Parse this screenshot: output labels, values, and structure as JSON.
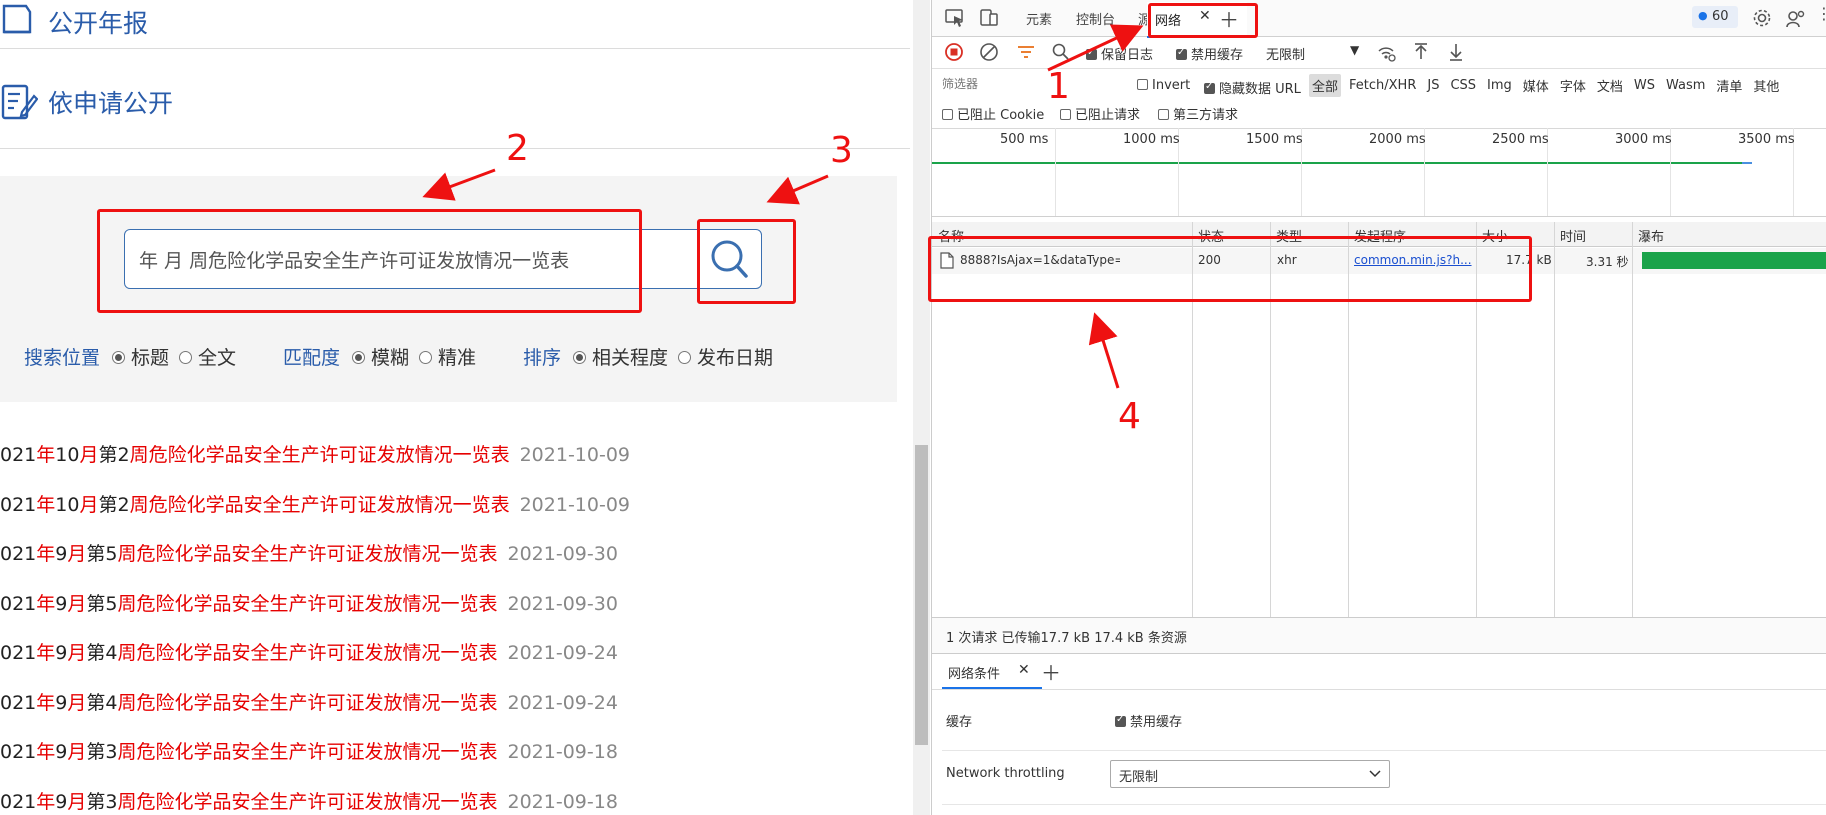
{
  "left": {
    "nav_items": [
      {
        "label": "公开年报",
        "icon": "annual-report-icon"
      },
      {
        "label": "依申请公开",
        "icon": "application-form-icon"
      }
    ],
    "search": {
      "value": "年 月 周危险化学品安全生产许可证发放情况一览表",
      "button_icon": "search-icon"
    },
    "options": [
      {
        "label": "搜索位置",
        "choices": [
          {
            "text": "标题",
            "selected": true
          },
          {
            "text": "全文",
            "selected": false
          }
        ]
      },
      {
        "label": "匹配度",
        "choices": [
          {
            "text": "模糊",
            "selected": true
          },
          {
            "text": "精准",
            "selected": false
          }
        ]
      },
      {
        "label": "排序",
        "choices": [
          {
            "text": "相关程度",
            "selected": true
          },
          {
            "text": "发布日期",
            "selected": false
          }
        ]
      }
    ],
    "results": [
      {
        "parts": [
          [
            "021",
            "black"
          ],
          [
            "年",
            "red"
          ],
          [
            "10",
            "black"
          ],
          [
            "月",
            "red"
          ],
          [
            "第2",
            "black"
          ],
          [
            "周危险化学品安全生产许可证发放情况一览表",
            "red"
          ]
        ],
        "date": "2021-10-09"
      },
      {
        "parts": [
          [
            "021",
            "black"
          ],
          [
            "年",
            "red"
          ],
          [
            "10",
            "black"
          ],
          [
            "月",
            "red"
          ],
          [
            "第2",
            "black"
          ],
          [
            "周危险化学品安全生产许可证发放情况一览表",
            "red"
          ]
        ],
        "date": "2021-10-09"
      },
      {
        "parts": [
          [
            "021",
            "black"
          ],
          [
            "年",
            "red"
          ],
          [
            "9",
            "black"
          ],
          [
            "月",
            "red"
          ],
          [
            "第5",
            "black"
          ],
          [
            "周危险化学品安全生产许可证发放情况一览表",
            "red"
          ]
        ],
        "date": "2021-09-30"
      },
      {
        "parts": [
          [
            "021",
            "black"
          ],
          [
            "年",
            "red"
          ],
          [
            "9",
            "black"
          ],
          [
            "月",
            "red"
          ],
          [
            "第5",
            "black"
          ],
          [
            "周危险化学品安全生产许可证发放情况一览表",
            "red"
          ]
        ],
        "date": "2021-09-30"
      },
      {
        "parts": [
          [
            "021",
            "black"
          ],
          [
            "年",
            "red"
          ],
          [
            "9",
            "black"
          ],
          [
            "月",
            "red"
          ],
          [
            "第4",
            "black"
          ],
          [
            "周危险化学品安全生产许可证发放情况一览表",
            "red"
          ]
        ],
        "date": "2021-09-24"
      },
      {
        "parts": [
          [
            "021",
            "black"
          ],
          [
            "年",
            "red"
          ],
          [
            "9",
            "black"
          ],
          [
            "月",
            "red"
          ],
          [
            "第4",
            "black"
          ],
          [
            "周危险化学品安全生产许可证发放情况一览表",
            "red"
          ]
        ],
        "date": "2021-09-24"
      },
      {
        "parts": [
          [
            "021",
            "black"
          ],
          [
            "年",
            "red"
          ],
          [
            "9",
            "black"
          ],
          [
            "月",
            "red"
          ],
          [
            "第3",
            "black"
          ],
          [
            "周危险化学品安全生产许可证发放情况一览表",
            "red"
          ]
        ],
        "date": "2021-09-18"
      },
      {
        "parts": [
          [
            "021",
            "black"
          ],
          [
            "年",
            "red"
          ],
          [
            "9",
            "black"
          ],
          [
            "月",
            "red"
          ],
          [
            "第3",
            "black"
          ],
          [
            "周危险化学品安全生产许可证发放情况一览表",
            "red"
          ]
        ],
        "date": "2021-09-18"
      }
    ]
  },
  "devtools": {
    "tabs": [
      {
        "label": "元素",
        "active": false
      },
      {
        "label": "控制台",
        "active": false
      },
      {
        "label": "源",
        "active": false
      },
      {
        "label": "网络",
        "active": true
      }
    ],
    "issues_badge": "60",
    "toolbar": {
      "preserve_log": "保留日志",
      "disable_cache": "禁用缓存",
      "throttle": "无限制"
    },
    "filter": {
      "placeholder": "筛选器",
      "invert": "Invert",
      "hide_data_urls": "隐藏数据 URL",
      "types": [
        "全部",
        "Fetch/XHR",
        "JS",
        "CSS",
        "Img",
        "媒体",
        "字体",
        "文档",
        "WS",
        "Wasm",
        "清单",
        "其他"
      ],
      "blocked_cookies": "已阻止 Cookie",
      "blocked_requests": "已阻止请求",
      "third_party": "第三方请求"
    },
    "timeline_ticks": [
      "500 ms",
      "1000 ms",
      "1500 ms",
      "2000 ms",
      "2500 ms",
      "3000 ms",
      "3500 ms"
    ],
    "columns": [
      "名称",
      "状态",
      "类型",
      "发起程序",
      "大小",
      "时间",
      "瀑布"
    ],
    "requests": [
      {
        "name": "8888?IsAjax=1&dataType=html&_=...",
        "status": "200",
        "type": "xhr",
        "initiator": "common.min.js?h...",
        "size": "17.7 kB",
        "time": "3.31 秒"
      }
    ],
    "status_bar": "1 次请求  已传输17.7 kB  17.4 kB 条资源",
    "drawer": {
      "tab": "网络条件",
      "cache_label": "缓存",
      "cache_checkbox": "禁用缓存",
      "throttling_label": "Network throttling",
      "throttling_value": "无限制"
    }
  },
  "annotations": [
    "1",
    "2",
    "3",
    "4"
  ],
  "colors": {
    "annotation": "#ee1111",
    "link_blue": "#2a5caa",
    "highlight_red": "#e60000",
    "waterfall_green": "#1aa34a"
  }
}
